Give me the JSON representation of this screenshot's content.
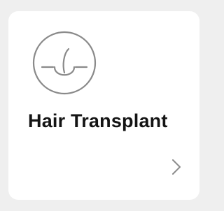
{
  "card": {
    "title": "Hair Transplant",
    "icon": "hair-follicle-icon",
    "action_icon": "chevron-right-icon"
  },
  "colors": {
    "background": "#efefef",
    "card": "#ffffff",
    "icon_stroke": "#8a8a8a",
    "title_text": "#141414",
    "chevron": "#8a8a8a"
  }
}
